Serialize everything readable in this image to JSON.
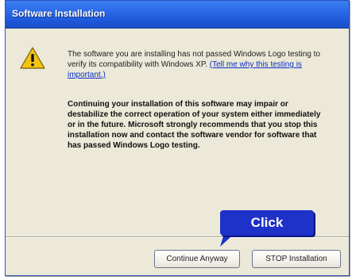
{
  "window": {
    "title": "Software Installation",
    "title_color": "#2b6ae8"
  },
  "icon": {
    "name": "warning-icon",
    "color": "#f2c414"
  },
  "message": {
    "intro": "The software you are installing has not passed Windows Logo testing to verify its compatibility with Windows XP. ",
    "link_text": "(Tell me why this testing is important.)",
    "warning": "Continuing your installation of this software may impair or destabilize the correct operation of your system either immediately or in the future. Microsoft strongly recommends that you stop this installation now and contact the software vendor for software that has passed Windows Logo testing."
  },
  "buttons": {
    "continue_label": "Continue Anyway",
    "stop_label": "STOP Installation"
  },
  "callout": {
    "label": "Click",
    "color": "#1e31c9"
  }
}
